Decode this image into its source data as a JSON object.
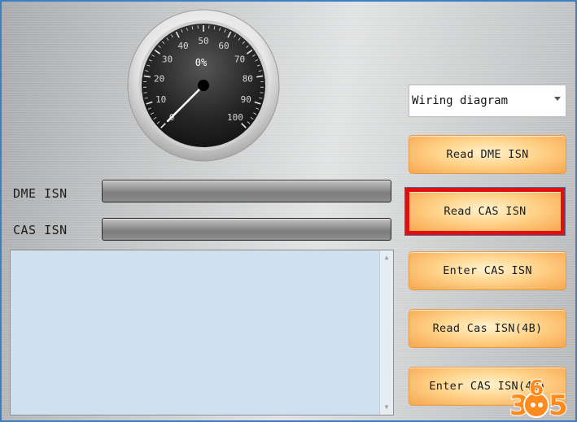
{
  "gauge": {
    "readout": "0%",
    "value": 0,
    "ticks": [
      "0",
      "10",
      "20",
      "30",
      "40",
      "50",
      "60",
      "70",
      "80",
      "90",
      "100"
    ]
  },
  "fields": {
    "dme_label": "DME ISN",
    "cas_label": "CAS ISN",
    "dme_progress": 0,
    "cas_progress": 0
  },
  "output": {
    "text": ""
  },
  "dropdown": {
    "selected": "Wiring diagram"
  },
  "buttons": {
    "read_dme": "Read DME ISN",
    "read_cas": "Read CAS ISN",
    "enter_cas": "Enter CAS ISN",
    "read_cas_4b": "Read Cas ISN(4B)",
    "enter_cas_4b": "Enter CAS ISN(4B)"
  },
  "watermark": {
    "digits": [
      "3",
      "6",
      "5"
    ]
  },
  "colors": {
    "frame": "#3e7fc4",
    "button": "#ffd48c",
    "selection": "#e01010",
    "output_bg": "#cfe0ef"
  }
}
